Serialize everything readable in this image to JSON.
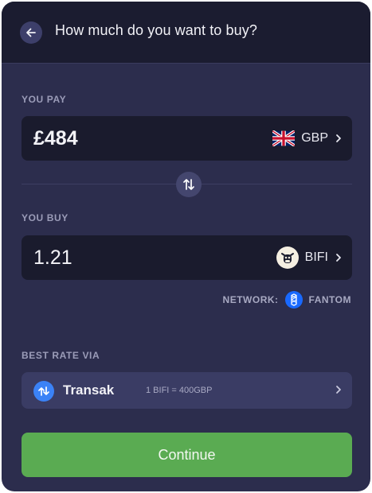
{
  "header": {
    "title": "How much do you want to buy?"
  },
  "pay": {
    "label": "YOU PAY",
    "amount": "£484",
    "currency": "GBP"
  },
  "buy": {
    "label": "YOU BUY",
    "amount": "1.21",
    "token": "BIFI"
  },
  "network": {
    "label": "NETWORK:",
    "name": "FANTOM"
  },
  "rate": {
    "label": "BEST RATE VIA",
    "provider": "Transak",
    "quote": "1 BIFI = 400GBP"
  },
  "actions": {
    "continue_label": "Continue"
  },
  "colors": {
    "background": "#2c2d4d",
    "header": "#1b1c30",
    "field": "#1a1b2d",
    "rate_box": "#3a3c64",
    "continue": "#5aab52",
    "transak": "#3b82f6",
    "fantom": "#1969ff"
  },
  "icons": {
    "back": "arrow-left-icon",
    "swap": "swap-arrows-icon",
    "currency": "uk-flag-icon",
    "token": "bifi-cow-icon",
    "network": "fantom-icon",
    "provider": "transak-icon",
    "chevron": "chevron-right-icon"
  }
}
